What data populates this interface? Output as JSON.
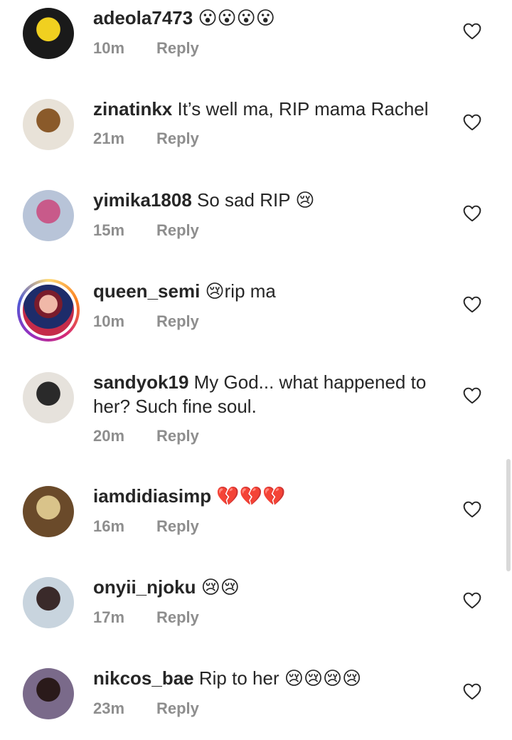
{
  "comments": [
    {
      "username": "adeola7473",
      "text": "",
      "emoji": "😮😮😮😮",
      "time": "10m",
      "reply": "Reply",
      "avatar_colors": [
        "#1a1a1a",
        "#f0d020"
      ]
    },
    {
      "username": "zinatinkx",
      "text": "It’s well ma, RIP mama Rachel",
      "emoji": "",
      "time": "21m",
      "reply": "Reply",
      "avatar_colors": [
        "#e8e2d8",
        "#8a5a2a"
      ]
    },
    {
      "username": "yimika1808",
      "text": "So sad RIP",
      "emoji": "😢",
      "time": "15m",
      "reply": "Reply",
      "avatar_colors": [
        "#b8c4d8",
        "#c85a8a"
      ]
    },
    {
      "username": "queen_semi",
      "text": "rip ma",
      "emoji": "😢",
      "emoji_first": true,
      "time": "10m",
      "reply": "Reply",
      "story_ring": true
    },
    {
      "username": "sandyok19",
      "text": "My God... what happened to her? Such fine soul.",
      "emoji": "",
      "time": "20m",
      "reply": "Reply",
      "avatar_colors": [
        "#e6e2dc",
        "#2a2a2a"
      ]
    },
    {
      "username": "iamdidiasimp",
      "text": "",
      "emoji": "💔💔💔",
      "time": "16m",
      "reply": "Reply",
      "avatar_colors": [
        "#6a4a2a",
        "#d9c38a"
      ]
    },
    {
      "username": "onyii_njoku",
      "text": "",
      "emoji": "😢😢",
      "time": "17m",
      "reply": "Reply",
      "avatar_colors": [
        "#c8d4de",
        "#3a2a2a"
      ]
    },
    {
      "username": "nikcos_bae",
      "text": "Rip to her",
      "emoji": "😢😢😢😢",
      "time": "23m",
      "reply": "Reply",
      "avatar_colors": [
        "#7a6a8a",
        "#2a1a1a"
      ]
    }
  ],
  "colors": {
    "text": "#262626",
    "meta": "#8e8e8e",
    "heart": "#262626",
    "scrollbar": "#d9d9d9"
  },
  "icons": {
    "like": "heart-outline-icon"
  }
}
